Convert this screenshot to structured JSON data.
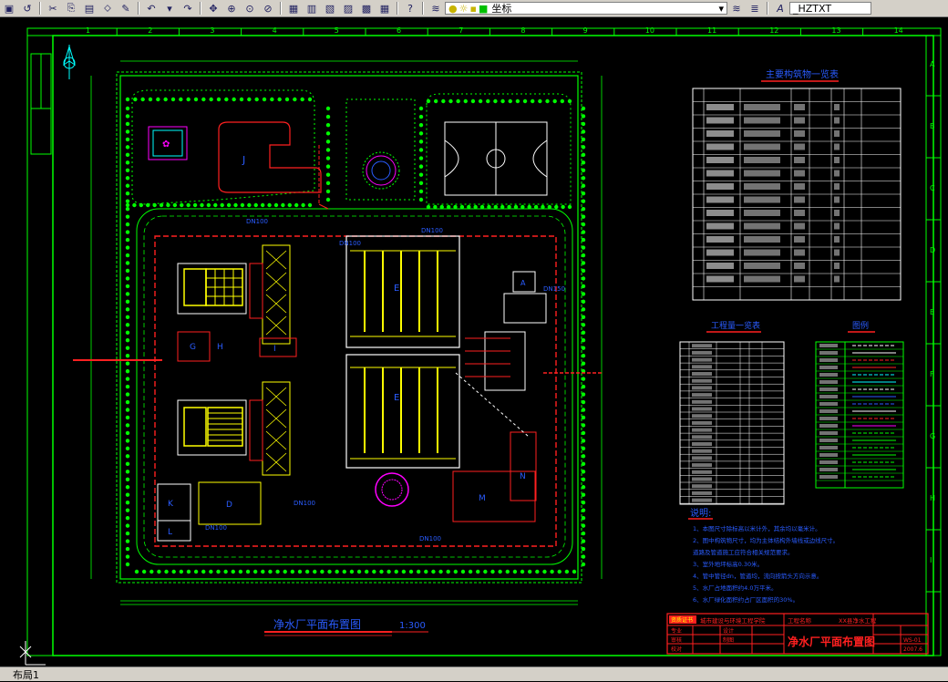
{
  "toolbar": {
    "coord_label": "坐标",
    "text_style": "_HZTXT",
    "icons": [
      "open-icon",
      "undo-icon",
      "cut-icon",
      "copy-icon",
      "paste-icon",
      "matchprop-icon",
      "brush-icon",
      "redo-icon",
      "pan-icon",
      "zoom-icon",
      "zoom-window-icon",
      "zoom-previous-icon",
      "properties-icon",
      "design-center-icon",
      "tool-palette-icon",
      "sheetset-icon",
      "markup-icon",
      "calculator-icon",
      "help-icon",
      "layers-icon",
      "bulb-icon",
      "sun-icon",
      "lock-icon",
      "color-icon"
    ]
  },
  "drawing": {
    "col_numbers": [
      "1",
      "2",
      "3",
      "4",
      "5",
      "6",
      "7",
      "8",
      "9",
      "10",
      "11",
      "12",
      "13",
      "14"
    ],
    "row_letters": [
      "A",
      "B",
      "C",
      "D",
      "E",
      "F",
      "G",
      "H",
      "I"
    ],
    "main_title": "净水厂平面布置图",
    "scale": "1:300",
    "table_main_title": "主要构筑物一览表",
    "table_works_title": "工程量一览表",
    "table_legend_title": "图例",
    "notes_title": "说明:",
    "notes": [
      "1、本图尺寸除标高以米计外，其余均以毫米计。",
      "2、图中构筑物尺寸，均为主体结构外墙线或边线尺寸。",
      "   道路及管道施工应符合相关规范要求。",
      "3、室外地坪标高0.30米。",
      "4、管中管径dn，管道均，流向按箭头方向示意。",
      "5、水厂占地面积约4.0万平米。",
      "6、水厂绿化面积约占厂区面积的30%。"
    ],
    "building_labels": [
      "J",
      "A",
      "E",
      "E",
      "G",
      "H",
      "I",
      "G",
      "K",
      "L",
      "D",
      "M",
      "N"
    ],
    "title_block": {
      "company_badge": "资质证书",
      "company": "城市建设与环境工程学院",
      "project_label": "工程名称",
      "project": "XX县净水工程",
      "drawing_title": "净水厂平面布置图",
      "row_labels": [
        "专业",
        "审核",
        "校对",
        "设计",
        "制图"
      ],
      "sheet_no": "WS-01",
      "date": "2007.6"
    },
    "pipe_labels": [
      "DN100",
      "DN100",
      "DN100",
      "DN100",
      "DN100",
      "DN100",
      "DN150"
    ]
  },
  "status": {
    "tab_label": "布局1"
  },
  "colors": {
    "frame": "#00ff00",
    "pipe_red": "#ff2020",
    "text_blue": "#2a5cff",
    "tank_yellow": "#ffff00",
    "magenta": "#ff00ff",
    "cyan": "#00ffff"
  }
}
